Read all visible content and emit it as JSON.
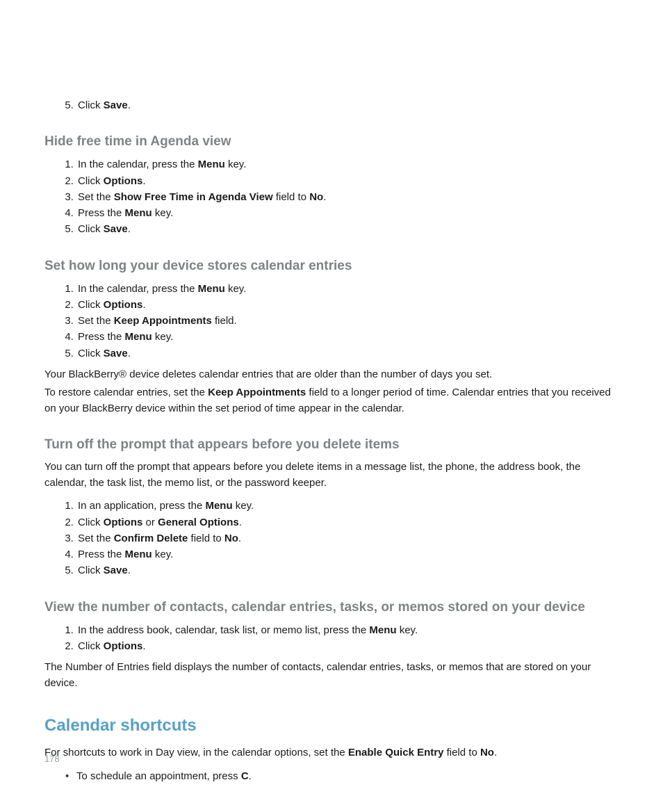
{
  "top_step5_prefix": "Click ",
  "top_step5_bold": "Save",
  "top_step5_suffix": ".",
  "s1": {
    "heading": "Hide free time in Agenda view",
    "steps": [
      {
        "pre": "In the calendar, press the ",
        "b": "Menu",
        "post": " key."
      },
      {
        "pre": "Click ",
        "b": "Options",
        "post": "."
      },
      {
        "pre": "Set the ",
        "b": "Show Free Time in Agenda View",
        "mid": " field to ",
        "b2": "No",
        "post": "."
      },
      {
        "pre": "Press the ",
        "b": "Menu",
        "post": " key."
      },
      {
        "pre": "Click ",
        "b": "Save",
        "post": "."
      }
    ]
  },
  "s2": {
    "heading": "Set how long your device stores calendar entries",
    "steps": [
      {
        "pre": "In the calendar, press the ",
        "b": "Menu",
        "post": " key."
      },
      {
        "pre": "Click ",
        "b": "Options",
        "post": "."
      },
      {
        "pre": "Set the ",
        "b": "Keep Appointments",
        "post": " field."
      },
      {
        "pre": "Press the ",
        "b": "Menu",
        "post": " key."
      },
      {
        "pre": "Click ",
        "b": "Save",
        "post": "."
      }
    ],
    "note1": "Your BlackBerry® device deletes calendar entries that are older than the number of days you set.",
    "note2_pre": "To restore calendar entries, set the ",
    "note2_b": "Keep Appointments",
    "note2_post": " field to a longer period of time. Calendar entries that you received on your BlackBerry device within the set period of time appear in the calendar."
  },
  "s3": {
    "heading": "Turn off the prompt that appears before you delete items",
    "intro": "You can turn off the prompt that appears before you delete items in a message list, the phone, the address book, the calendar, the task list, the memo list, or the password keeper.",
    "steps": [
      {
        "pre": "In an application, press the ",
        "b": "Menu",
        "post": " key."
      },
      {
        "pre": "Click ",
        "b": "Options",
        "mid": " or ",
        "b2": "General Options",
        "post": "."
      },
      {
        "pre": "Set the ",
        "b": "Confirm Delete",
        "mid": " field to ",
        "b2": "No",
        "post": "."
      },
      {
        "pre": "Press the ",
        "b": "Menu",
        "post": " key."
      },
      {
        "pre": "Click ",
        "b": "Save",
        "post": "."
      }
    ]
  },
  "s4": {
    "heading": "View the number of contacts, calendar entries, tasks, or memos stored on your device",
    "steps": [
      {
        "pre": "In the address book, calendar, task list, or memo list, press the ",
        "b": "Menu",
        "post": " key."
      },
      {
        "pre": "Click ",
        "b": "Options",
        "post": "."
      }
    ],
    "note": "The Number of Entries field displays the number of contacts, calendar entries, tasks, or memos that are stored on your device."
  },
  "shortcuts": {
    "heading": "Calendar shortcuts",
    "intro_pre": "For shortcuts to work in Day view, in the calendar options, set the ",
    "intro_b": "Enable Quick Entry",
    "intro_mid": " field to ",
    "intro_b2": "No",
    "intro_post": ".",
    "bullets": [
      {
        "pre": "To schedule an appointment, press ",
        "b": "C",
        "post": "."
      }
    ]
  },
  "page_number": "178"
}
